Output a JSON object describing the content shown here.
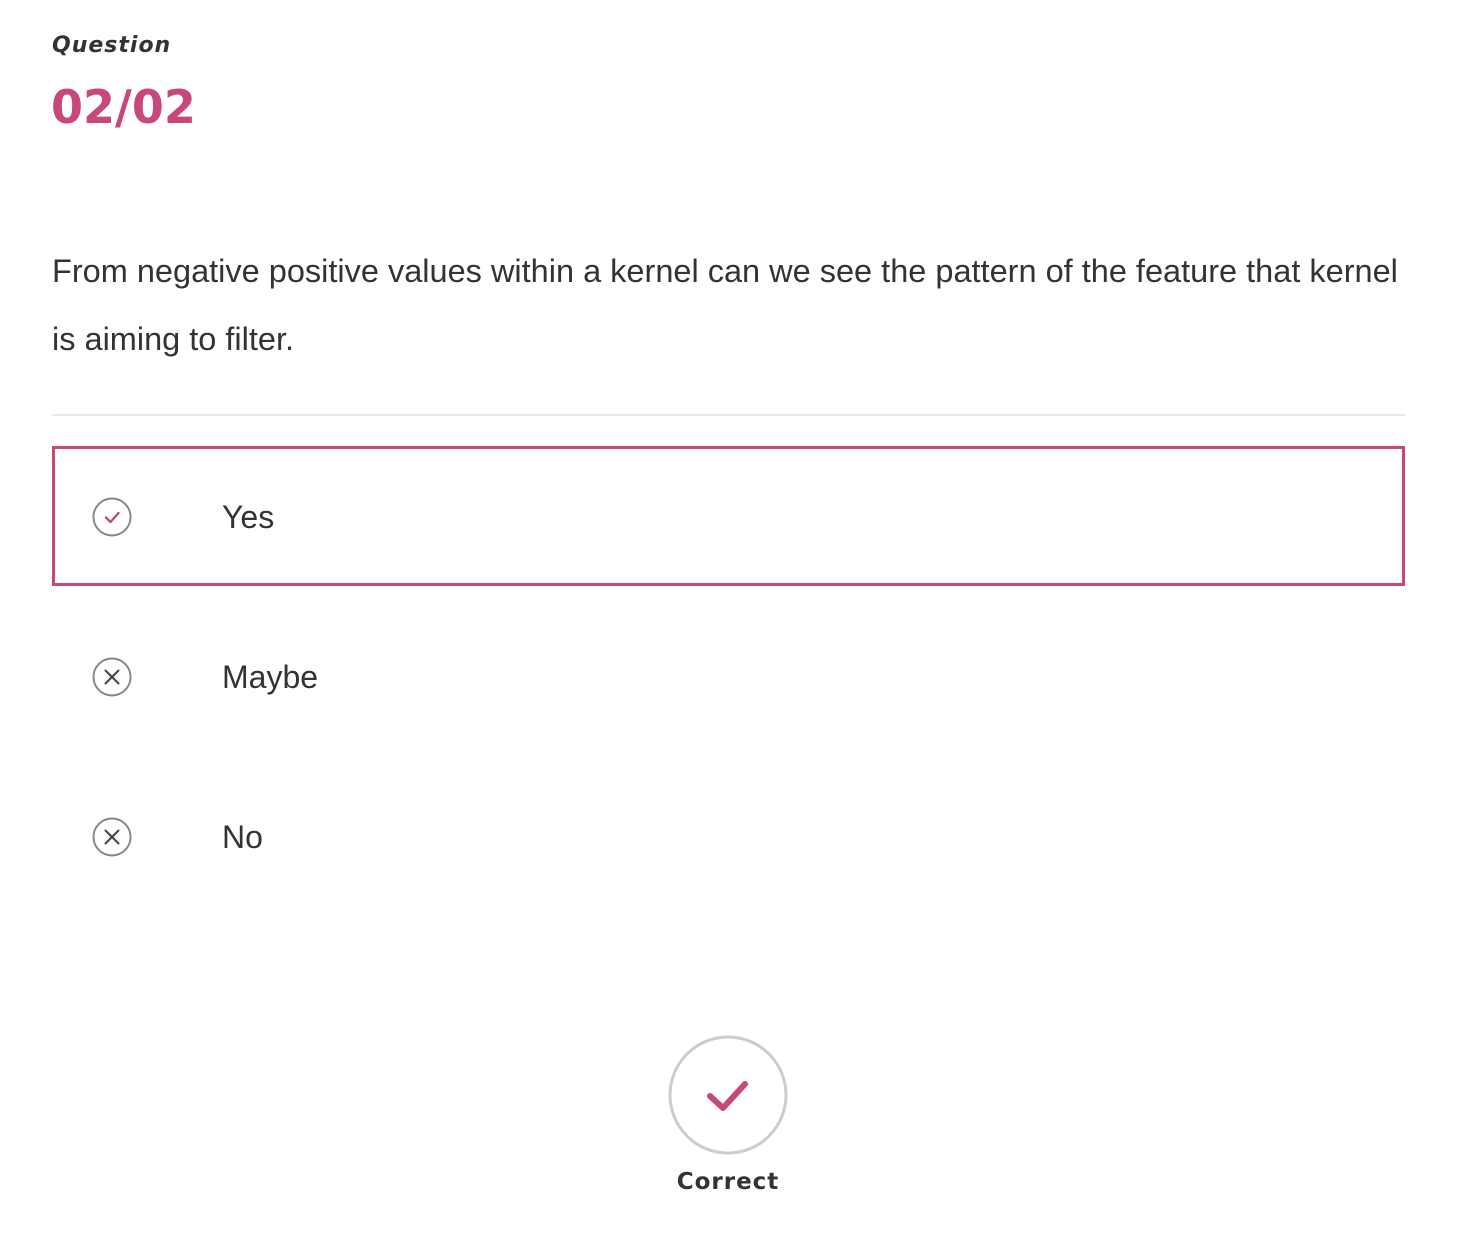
{
  "colors": {
    "accent": "#c9487b",
    "text": "#333333",
    "icon_gray": "#888888",
    "divider": "#e8e8e8",
    "badge_ring": "#cccccc"
  },
  "question": {
    "label": "Question",
    "counter": "02/02",
    "text": "From negative positive values within a kernel can we see the pattern of the feature that kernel is aiming to filter."
  },
  "options": [
    {
      "label": "Yes",
      "icon": "check-circle-icon",
      "selected": true
    },
    {
      "label": "Maybe",
      "icon": "x-circle-icon",
      "selected": false
    },
    {
      "label": "No",
      "icon": "x-circle-icon",
      "selected": false
    }
  ],
  "result": {
    "label": "Correct",
    "icon": "check-icon"
  }
}
